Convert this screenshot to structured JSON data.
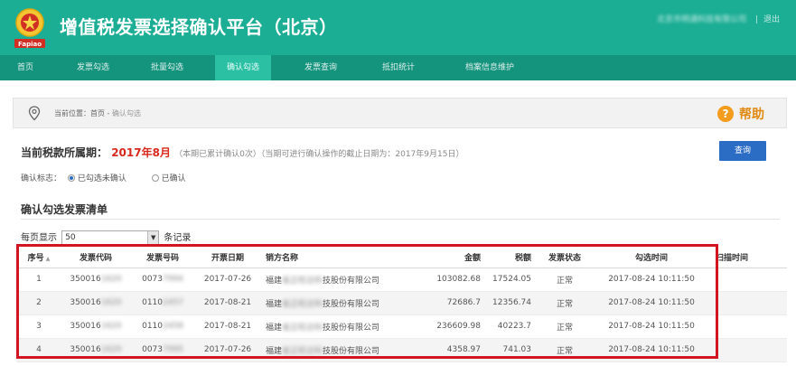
{
  "header": {
    "title": "增值税发票选择确认平台（北京）",
    "logo_text": "Fapiao",
    "user_name": "北京市明通科技有限公司",
    "logout": "退出"
  },
  "nav": {
    "items": [
      "首页",
      "发票勾选",
      "批量勾选",
      "确认勾选",
      "发票查询",
      "抵扣统计",
      "档案信息维护"
    ],
    "active_index": 3
  },
  "breadcrumb": {
    "prefix": "当前位置：首页 -",
    "current": "确认勾选"
  },
  "help_label": "帮助",
  "period": {
    "label": "当前税款所属期：",
    "value": "2017年8月",
    "note": "（本期已累计确认0次）（当期可进行确认操作的截止日期为：2017年9月15日）"
  },
  "query_button": "查询",
  "confirm_flag": {
    "label": "确认标志：",
    "options": [
      "已勾选未确认",
      "已确认"
    ],
    "selected_index": 0
  },
  "list_title": "确认勾选发票清单",
  "pagination": {
    "per_page_label": "每页显示",
    "per_page_value": "50",
    "suffix": "条记录"
  },
  "table": {
    "columns": [
      "序号",
      "发票代码",
      "发票号码",
      "开票日期",
      "销方名称",
      "金额",
      "税额",
      "发票状态",
      "勾选时间",
      "扫描时间"
    ],
    "rows": [
      {
        "no": "1",
        "code_prefix": "350016",
        "code_hidden": "1620",
        "num_prefix": "0073",
        "num_hidden": "7994",
        "date": "2017-07-26",
        "seller_prefix": "福建",
        "seller_hidden": "省正旺达科",
        "seller_suffix": "技股份有限公司",
        "amount": "103082.68",
        "tax": "17524.05",
        "status": "正常",
        "time": "2017-08-24 10:11:50"
      },
      {
        "no": "2",
        "code_prefix": "350016",
        "code_hidden": "1620",
        "num_prefix": "0110",
        "num_hidden": "2457",
        "date": "2017-08-21",
        "seller_prefix": "福建",
        "seller_hidden": "省正旺达科",
        "seller_suffix": "技股份有限公司",
        "amount": "72686.7",
        "tax": "12356.74",
        "status": "正常",
        "time": "2017-08-24 10:11:50"
      },
      {
        "no": "3",
        "code_prefix": "350016",
        "code_hidden": "1620",
        "num_prefix": "0110",
        "num_hidden": "2458",
        "date": "2017-08-21",
        "seller_prefix": "福建",
        "seller_hidden": "省正旺达科",
        "seller_suffix": "技股份有限公司",
        "amount": "236609.98",
        "tax": "40223.7",
        "status": "正常",
        "time": "2017-08-24 10:11:50"
      },
      {
        "no": "4",
        "code_prefix": "350016",
        "code_hidden": "1620",
        "num_prefix": "0073",
        "num_hidden": "7995",
        "date": "2017-07-26",
        "seller_prefix": "福建",
        "seller_hidden": "省正旺达科",
        "seller_suffix": "技股份有限公司",
        "amount": "4358.97",
        "tax": "741.03",
        "status": "正常",
        "time": "2017-08-24 10:11:50"
      }
    ]
  },
  "colors": {
    "header_bg": "#1cae95",
    "nav_bg": "#14937d",
    "nav_active": "#2bbfa4",
    "accent_red": "#d9281d",
    "button_blue": "#2b6cc4",
    "help_orange": "#f39c1e",
    "highlight_red": "#d11523"
  },
  "icons": [
    "national-emblem-logo-icon",
    "location-pin-icon",
    "help-question-icon",
    "sort-ascending-icon",
    "dropdown-arrow-icon"
  ]
}
